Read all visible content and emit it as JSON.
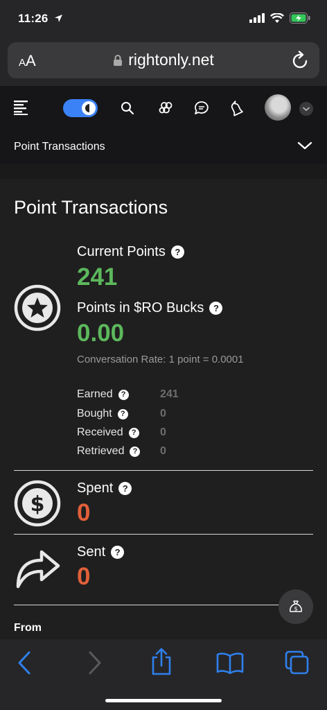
{
  "status_bar": {
    "time": "11:26"
  },
  "browser": {
    "aa_small": "A",
    "aa_large": "A",
    "url": "rightonly.net"
  },
  "header": {
    "icons": [
      "menu-icon",
      "theme-toggle",
      "search-icon",
      "groups-icon",
      "chat-icon",
      "notifications-icon",
      "avatar",
      "chevron-down-icon"
    ],
    "subnav_title": "Point Transactions"
  },
  "main": {
    "page_title": "Point Transactions",
    "current_points_label": "Current Points",
    "current_points_value": "241",
    "ro_bucks_label": "Points in $RO Bucks",
    "ro_bucks_value": "0.00",
    "conversion_rate": "Conversation Rate: 1 point = 0.0001",
    "stats": [
      {
        "label": "Earned",
        "value": "241"
      },
      {
        "label": "Bought",
        "value": "0"
      },
      {
        "label": "Received",
        "value": "0"
      },
      {
        "label": "Retrieved",
        "value": "0"
      }
    ],
    "spent_label": "Spent",
    "spent_value": "0",
    "sent_label": "Sent",
    "sent_value": "0",
    "from_label": "From"
  },
  "colors": {
    "positive": "#5cb85c",
    "negative": "#e0603a",
    "accent": "#3b82f6"
  },
  "toolbar": {
    "icons": [
      "back-icon",
      "forward-icon",
      "share-icon",
      "bookmarks-icon",
      "tabs-icon"
    ]
  }
}
